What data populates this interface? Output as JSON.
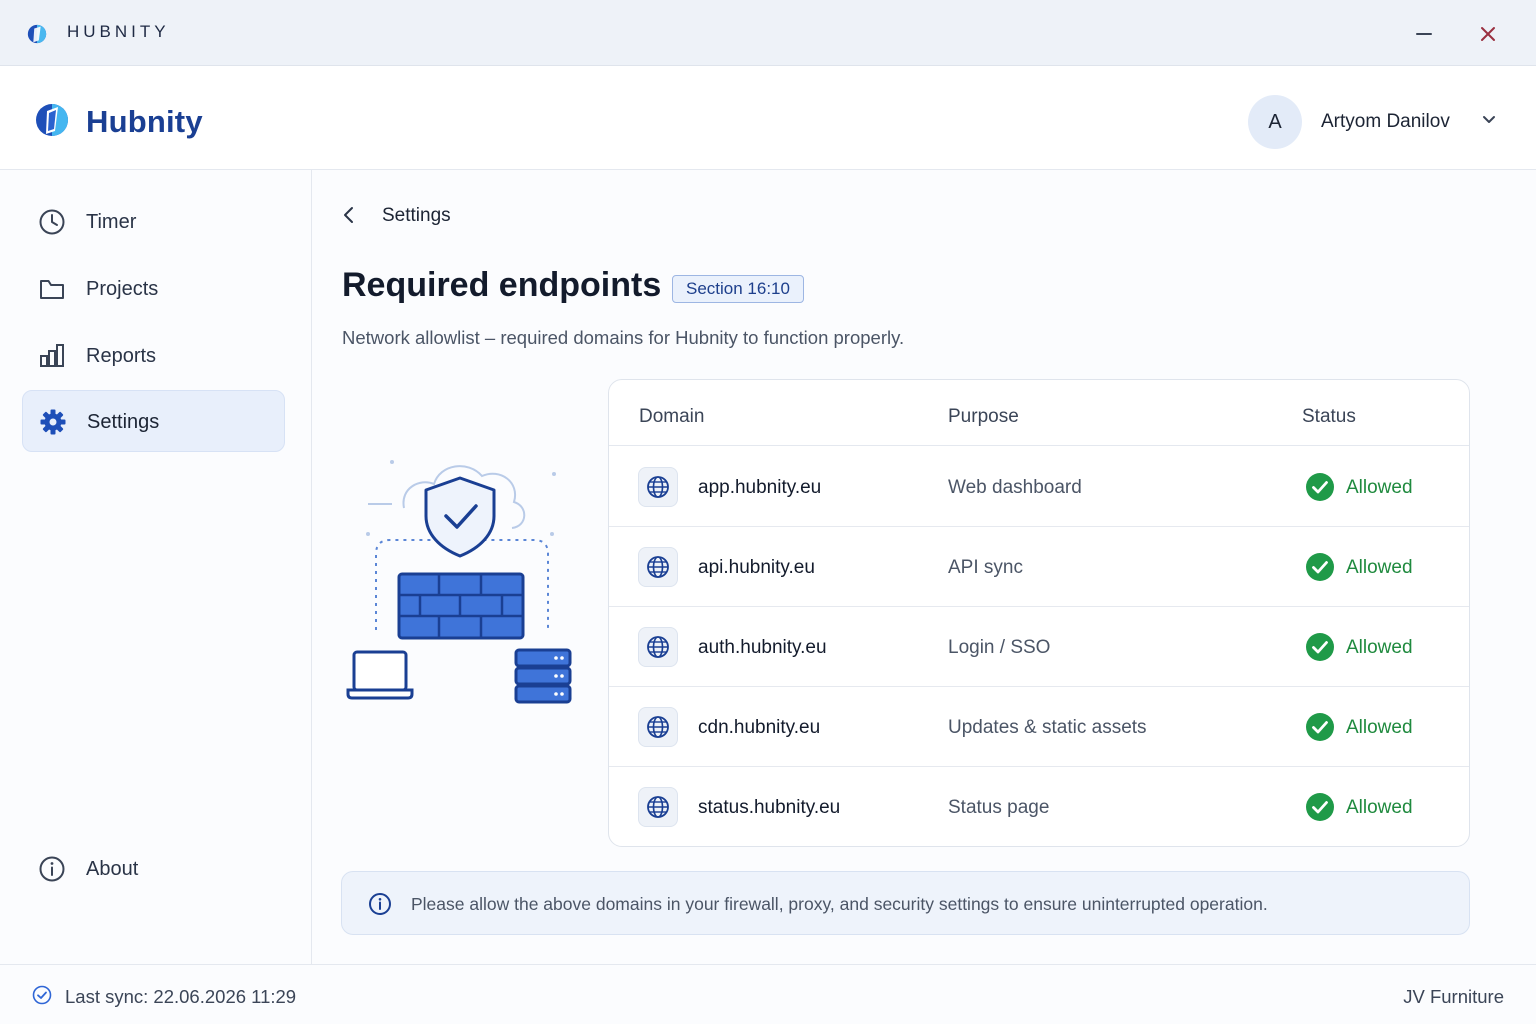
{
  "titlebar": {
    "app_name": "HUBNITY",
    "minimize_icon": "minimize-icon",
    "close_icon": "close-icon"
  },
  "header": {
    "brand": "Hubnity",
    "user": {
      "initial": "A",
      "name": "Artyom Danilov"
    }
  },
  "sidebar": {
    "items": [
      {
        "label": "Timer",
        "icon": "clock-icon",
        "active": false
      },
      {
        "label": "Projects",
        "icon": "folder-icon",
        "active": false
      },
      {
        "label": "Reports",
        "icon": "bar-chart-icon",
        "active": false
      },
      {
        "label": "Settings",
        "icon": "gear-icon",
        "active": true
      }
    ],
    "about": {
      "label": "About",
      "icon": "info-icon"
    }
  },
  "main": {
    "breadcrumb": "Settings",
    "title": "Required endpoints",
    "badge": "Section 16:10",
    "subtitle": "Network allowlist – required domains for Hubnity to function properly.",
    "table": {
      "headers": {
        "domain": "Domain",
        "purpose": "Purpose",
        "status": "Status"
      },
      "rows": [
        {
          "domain": "app.hubnity.eu",
          "purpose": "Web dashboard",
          "status": "Allowed"
        },
        {
          "domain": "api.hubnity.eu",
          "purpose": "API sync",
          "status": "Allowed"
        },
        {
          "domain": "auth.hubnity.eu",
          "purpose": "Login / SSO",
          "status": "Allowed"
        },
        {
          "domain": "cdn.hubnity.eu",
          "purpose": "Updates & static assets",
          "status": "Allowed"
        },
        {
          "domain": "status.hubnity.eu",
          "purpose": "Status page",
          "status": "Allowed"
        }
      ]
    },
    "info": "Please allow the above domains in your firewall, proxy, and security settings to ensure uninterrupted operation."
  },
  "footer": {
    "sync": "Last sync: 22.06.2026 11:29",
    "company": "JV Furniture"
  },
  "colors": {
    "brand": "#1a3f93",
    "accent": "#2f66d6",
    "success": "#1f9a48",
    "active_bg": "#e8effb"
  }
}
